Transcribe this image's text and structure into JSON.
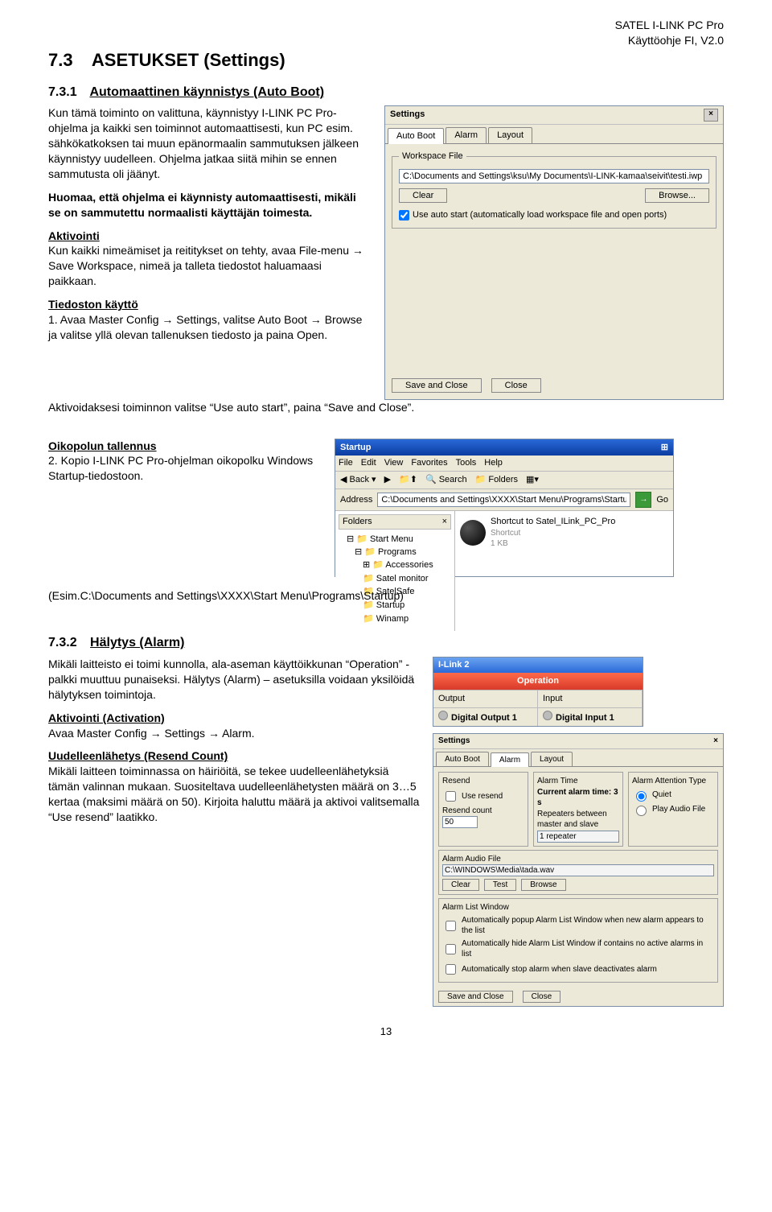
{
  "header": {
    "line1": "SATEL I-LINK PC Pro",
    "line2": "Käyttöohje FI, V2.0"
  },
  "section": {
    "number": "7.3",
    "title": "ASETUKSET (Settings)"
  },
  "sub1": {
    "number": "7.3.1",
    "title": "Automaattinen käynnistys (Auto Boot)",
    "para1": "Kun tämä toiminto on valittuna, käynnistyy I-LINK PC Pro-ohjelma ja kaikki sen toiminnot automaattisesti, kun PC esim. sähkökatkoksen tai muun epänormaalin sammutuksen jälkeen käynnistyy uudelleen. Ohjelma jatkaa siitä mihin se ennen sammutusta oli jäänyt.",
    "para1b": "Huomaa, että ohjelma ei käynnisty automaattisesti, mikäli se on sammutettu normaalisti käyttäjän toimesta.",
    "aktivointi_head": "Aktivointi",
    "aktivointi_body": "Kun kaikki nimeämiset ja reititykset on tehty, avaa File-menu → Save Workspace, nimeä ja talleta tiedostot haluamaasi paikkaan.",
    "tiedoston_head": "Tiedoston käyttö",
    "tiedoston_body": "1. Avaa Master Config → Settings, valitse Auto Boot → Browse ja valitse yllä olevan tallenuksen tiedosto ja paina Open.",
    "tiedoston_body2": "Aktivoidaksesi toiminnon valitse “Use auto start”, paina “Save and Close”.",
    "oikopolku_head": "Oikopolun tallennus",
    "oikopolku_body": "2. Kopio I-LINK PC Pro-ohjelman oikopolku Windows Startup-tiedostoon.",
    "oikopolku_path": "(Esim.C:\\Documents and Settings\\XXXX\\Start Menu\\Programs\\Startup)"
  },
  "settings_dialog": {
    "title": "Settings",
    "tabs": [
      "Auto Boot",
      "Alarm",
      "Layout"
    ],
    "group_label": "Workspace File",
    "path": "C:\\Documents and Settings\\ksu\\My Documents\\I-LINK-kamaa\\seivit\\testi.iwp",
    "clear": "Clear",
    "browse": "Browse...",
    "checkbox": "Use auto start (automatically load workspace file and open ports)",
    "save_close": "Save and Close",
    "close": "Close"
  },
  "explorer": {
    "title": "Startup",
    "menu": [
      "File",
      "Edit",
      "View",
      "Favorites",
      "Tools",
      "Help"
    ],
    "back": "Back",
    "search": "Search",
    "folders": "Folders",
    "address_label": "Address",
    "address": "C:\\Documents and Settings\\XXXX\\Start Menu\\Programs\\Startup",
    "go": "Go",
    "tree_header": "Folders",
    "tree": [
      "Start Menu",
      "Programs",
      "Accessories",
      "Satel monitor",
      "SatelSafe",
      "Startup",
      "Winamp"
    ],
    "shortcut_name": "Shortcut to Satel_ILink_PC_Pro",
    "shortcut_type": "Shortcut",
    "shortcut_size": "1 KB"
  },
  "sub2": {
    "number": "7.3.2",
    "title": "Hälytys (Alarm)",
    "para1": "Mikäli laitteisto ei toimi kunnolla, ala-aseman käyttöikkunan “Operation” -palkki muuttuu punaiseksi. Hälytys (Alarm) – asetuksilla voidaan yksilöidä hälytyksen toimintoja.",
    "act_head": "Aktivointi (Activation)",
    "act_body": "Avaa Master Config → Settings → Alarm.",
    "resend_head": "Uudelleenlähetys (Resend Count)",
    "resend_body": "Mikäli laitteen toiminnassa on häiriöitä, se tekee uudelleenlähetyksiä tämän valinnan mukaan. Suositeltava uudelleenlähetysten määrä on 3…5 kertaa (maksimi määrä on 50). Kirjoita haluttu määrä ja aktivoi valitsemalla “Use resend” laatikko."
  },
  "ilink": {
    "title": "I-Link 2",
    "operation": "Operation",
    "output_label": "Output",
    "output_val": "Digital Output 1",
    "input_label": "Input",
    "input_val": "Digital Input 1"
  },
  "alarm_dialog": {
    "title": "Settings",
    "tabs": [
      "Auto Boot",
      "Alarm",
      "Layout"
    ],
    "resend_group": "Resend",
    "use_resend": "Use resend",
    "resend_count": "Resend count",
    "resend_val": "50",
    "alarmtime_group": "Alarm Time",
    "current_alarm": "Current alarm time: 3 s",
    "repeaters": "Repeaters between master and slave",
    "repeater_val": "1 repeater",
    "atten_group": "Alarm Attention Type",
    "quiet": "Quiet",
    "play_audio": "Play Audio File",
    "audio_group": "Alarm Audio File",
    "audio_path": "C:\\WINDOWS\\Media\\tada.wav",
    "clear": "Clear",
    "test": "Test",
    "browse": "Browse",
    "listwin_group": "Alarm List Window",
    "chk1": "Automatically popup Alarm List Window when new alarm appears to the list",
    "chk2": "Automatically hide Alarm List Window if contains no active alarms in list",
    "chk3": "Automatically stop alarm when slave deactivates alarm",
    "save_close": "Save and Close",
    "close": "Close"
  },
  "page_number": "13"
}
